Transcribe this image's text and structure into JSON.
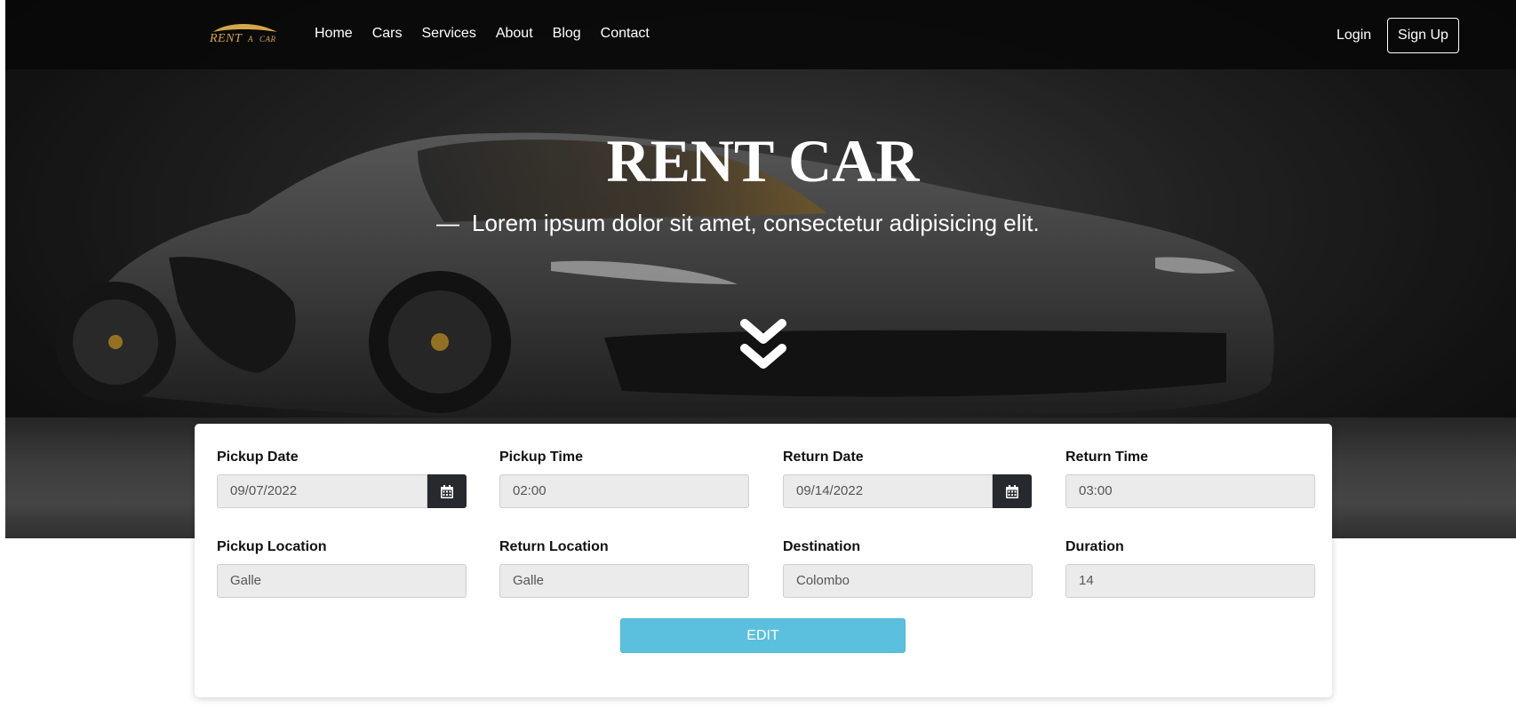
{
  "brand": {
    "logo_main": "RENT",
    "logo_a": "A",
    "logo_car": "CAR"
  },
  "nav": {
    "links": [
      "Home",
      "Cars",
      "Services",
      "About",
      "Blog",
      "Contact"
    ],
    "login": "Login",
    "signup": "Sign Up"
  },
  "hero": {
    "title": "RENT CAR",
    "dash": "—",
    "subtitle": "Lorem ipsum dolor sit amet, consectetur adipisicing elit."
  },
  "form": {
    "pickup_date": {
      "label": "Pickup Date",
      "value": "09/07/2022"
    },
    "pickup_time": {
      "label": "Pickup Time",
      "value": "02:00"
    },
    "return_date": {
      "label": "Return Date",
      "value": "09/14/2022"
    },
    "return_time": {
      "label": "Return Time",
      "value": "03:00"
    },
    "pickup_location": {
      "label": "Pickup Location",
      "value": "Galle"
    },
    "return_location": {
      "label": "Return Location",
      "value": "Galle"
    },
    "destination": {
      "label": "Destination",
      "value": "Colombo"
    },
    "duration": {
      "label": "Duration",
      "value": "14"
    },
    "edit_button": "EDIT"
  },
  "colors": {
    "accent": "#5bc0de",
    "logo_gold": "#d4a64a",
    "calendar_button": "#26292e"
  },
  "icons": {
    "calendar": "calendar-icon",
    "scroll": "chevron-double-down-icon"
  }
}
